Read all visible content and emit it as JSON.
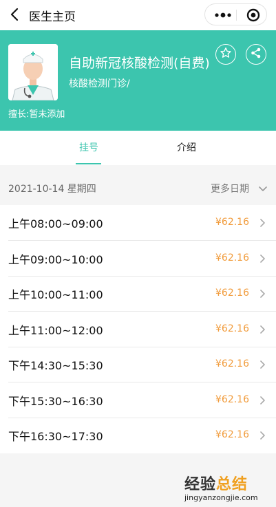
{
  "nav": {
    "title": "医生主页"
  },
  "doctor": {
    "name": "自助新冠核酸检测(自费)",
    "department": "核酸检测门诊/",
    "specialty": "擅长:暂未添加"
  },
  "tabs": [
    {
      "label": "挂号"
    },
    {
      "label": "介绍"
    }
  ],
  "schedule": {
    "date": "2021-10-14 星期四",
    "more_label": "更多日期",
    "slots": [
      {
        "time": "上午08:00~09:00",
        "price": "¥62.16"
      },
      {
        "time": "上午09:00~10:00",
        "price": "¥62.16"
      },
      {
        "time": "上午10:00~11:00",
        "price": "¥62.16"
      },
      {
        "time": "上午11:00~12:00",
        "price": "¥62.16"
      },
      {
        "time": "下午14:30~15:30",
        "price": "¥62.16"
      },
      {
        "time": "下午15:30~16:30",
        "price": "¥62.16"
      },
      {
        "time": "下午16:30~17:30",
        "price": "¥62.16"
      }
    ]
  },
  "watermark": {
    "title_a": "经验",
    "title_b": "总结",
    "url": "jingyanzongjie.com"
  },
  "colors": {
    "accent": "#3cc5ae",
    "price": "#f19b3b"
  }
}
